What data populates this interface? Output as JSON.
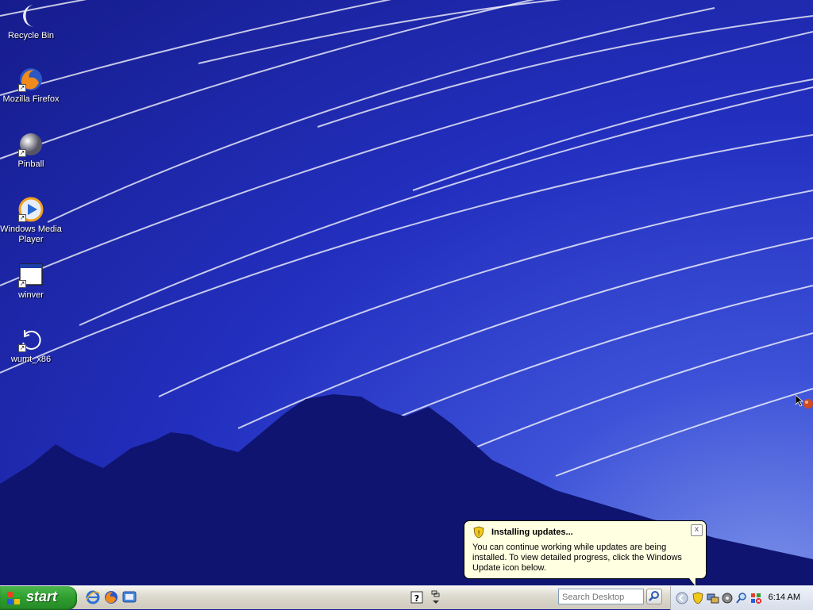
{
  "desktop": {
    "icons": [
      {
        "label": "Recycle Bin",
        "icon": "recycle-bin-icon"
      },
      {
        "label": "Mozilla Firefox",
        "icon": "firefox-icon"
      },
      {
        "label": "Pinball",
        "icon": "pinball-icon"
      },
      {
        "label": "Windows Media Player",
        "icon": "media-player-icon"
      },
      {
        "label": "winver",
        "icon": "window-app-icon"
      },
      {
        "label": "wumt_x86",
        "icon": "update-tool-icon"
      }
    ],
    "shortcut_arrow": "↗"
  },
  "balloon": {
    "title": "Installing updates...",
    "body": "You can continue working while updates are being installed. To view detailed progress, click the Windows Update icon below.",
    "close": "x",
    "icon": "windows-update-shield-icon"
  },
  "taskbar": {
    "start_label": "start",
    "quick_launch": [
      "internet-explorer-icon",
      "firefox-icon",
      "show-desktop-icon"
    ],
    "help_icon": "help-icon",
    "search_placeholder": "Search Desktop",
    "tray_icons": [
      "collapse-arrow-icon",
      "windows-update-shield-icon",
      "network-icon",
      "volume-icon",
      "search-tray-icon",
      "security-icon"
    ],
    "clock": "6:14 AM"
  },
  "colors": {
    "balloon_bg": "#ffffe1",
    "start_green": "#2e9c2e",
    "sky_blue": "#2330c0"
  }
}
